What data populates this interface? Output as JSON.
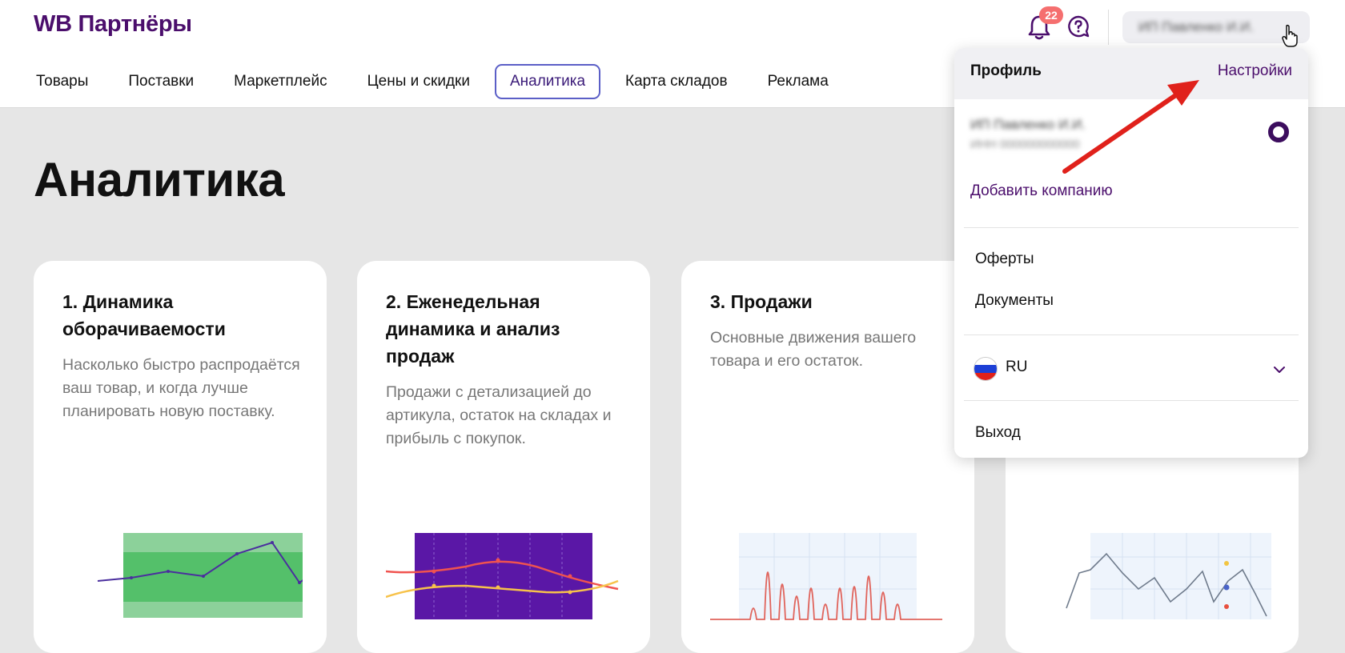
{
  "header": {
    "logo": "WB Партнёры",
    "notifications_count": "22",
    "user_name": "ИП Павленко И.И.",
    "nav": [
      "Товары",
      "Поставки",
      "Маркетплейс",
      "Цены и скидки",
      "Аналитика",
      "Карта складов",
      "Реклама"
    ],
    "active_nav": "Аналитика"
  },
  "page": {
    "title": "Аналитика",
    "cards": [
      {
        "title": "1. Динамика оборачиваемости",
        "desc": "Насколько быстро распродаётся ваш товар, и когда лучше планировать новую поставку."
      },
      {
        "title": "2. Еженедельная динамика и анализ продаж",
        "desc": "Продажи с детализацией до артикула, остаток на складах и прибыль с покупок."
      },
      {
        "title": "3. Продажи",
        "desc": "Основные движения вашего товара и его остаток."
      }
    ]
  },
  "dropdown": {
    "title": "Профиль",
    "settings": "Настройки",
    "company_name": "ИП Павленко И.И.",
    "company_id": "ИНН 000000000000",
    "add_company": "Добавить компанию",
    "offers": "Оферты",
    "documents": "Документы",
    "language": "RU",
    "logout": "Выход"
  },
  "colors": {
    "brand": "#4b0e6c",
    "accent_outline": "#5b5fc7",
    "badge": "#f56f6f",
    "annotation_arrow": "#e0211b"
  }
}
